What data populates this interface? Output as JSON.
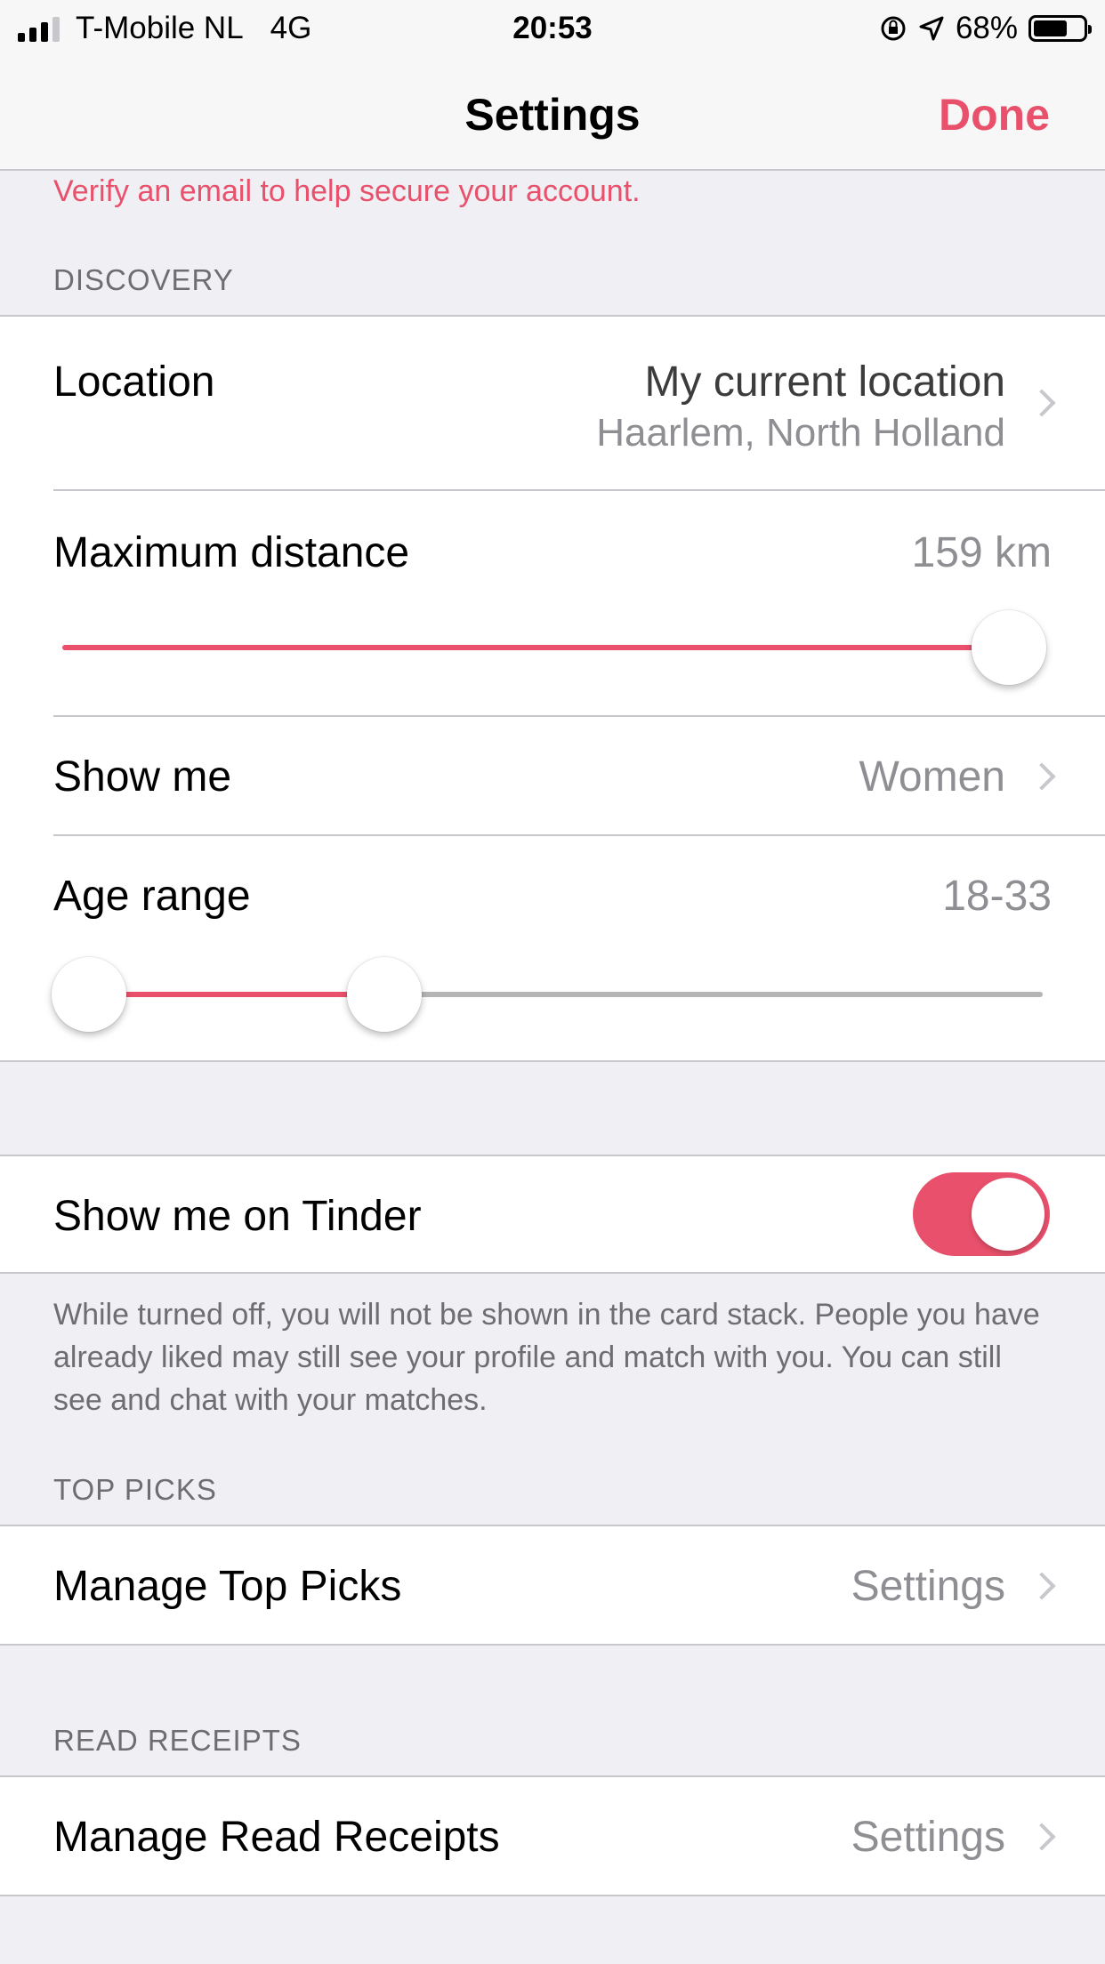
{
  "status_bar": {
    "carrier": "T-Mobile NL",
    "network": "4G",
    "time": "20:53",
    "battery": "68%",
    "battery_level": 0.68,
    "signal_bars": 3
  },
  "nav": {
    "title": "Settings",
    "done": "Done"
  },
  "verify_email_text": "Verify an email to help secure your account.",
  "discovery": {
    "header": "DISCOVERY",
    "location": {
      "label": "Location",
      "value": "My current location",
      "subvalue": "Haarlem, North Holland"
    },
    "max_distance": {
      "label": "Maximum distance",
      "value": "159 km",
      "slider_fraction": 1.0
    },
    "show_me": {
      "label": "Show me",
      "value": "Women"
    },
    "age_range": {
      "label": "Age range",
      "value": "18-33",
      "min_fraction": 0.0,
      "max_fraction": 0.31
    }
  },
  "show_on_tinder": {
    "label": "Show me on Tinder",
    "enabled": true,
    "footnote": "While turned off, you will not be shown in the card stack. People you have already liked may still see your profile and match with you. You can still see and chat with your matches."
  },
  "top_picks": {
    "header": "TOP PICKS",
    "label": "Manage Top Picks",
    "value": "Settings"
  },
  "read_receipts": {
    "header": "READ RECEIPTS",
    "label": "Manage Read Receipts",
    "value": "Settings"
  },
  "colors": {
    "accent": "#e9506b",
    "secondary_text": "#8e8e93",
    "track_inactive": "#b5b5b5"
  }
}
